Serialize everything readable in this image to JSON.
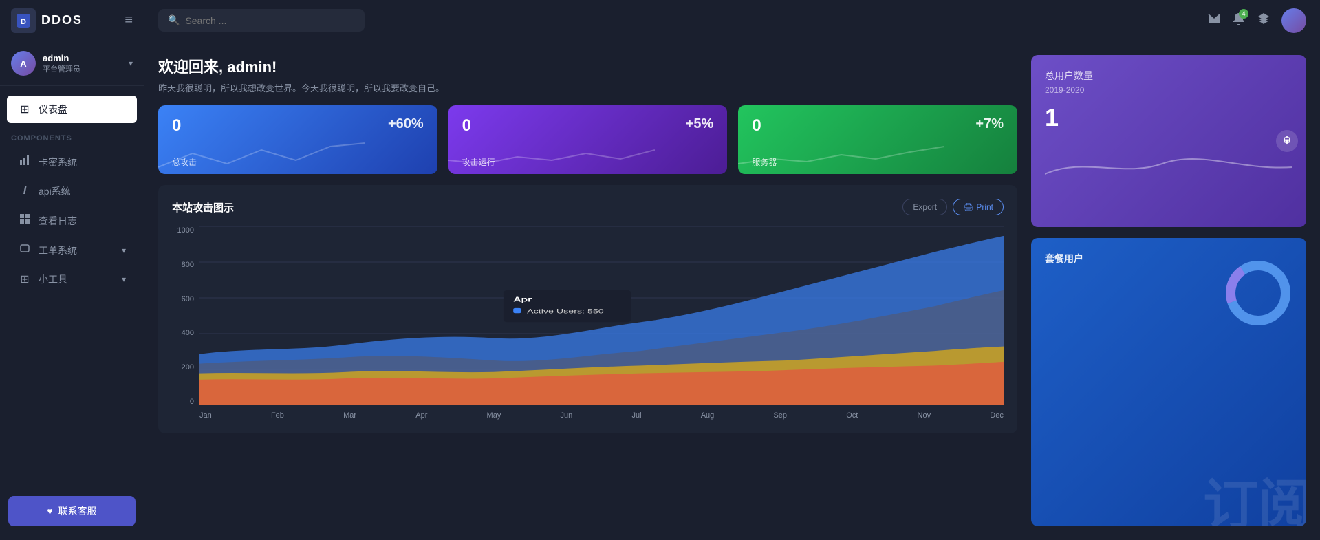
{
  "app": {
    "logo_text": "DDOS",
    "logo_icon": "D"
  },
  "sidebar": {
    "hamburger": "≡",
    "user": {
      "name": "admin",
      "role": "平台管理员"
    },
    "nav": [
      {
        "id": "dashboard",
        "label": "仪表盘",
        "icon": "⊞",
        "active": true
      }
    ],
    "components_label": "COMPONENTS",
    "component_items": [
      {
        "id": "card-system",
        "label": "卡密系统",
        "icon": "📊"
      },
      {
        "id": "api-system",
        "label": "api系统",
        "icon": "I"
      },
      {
        "id": "view-log",
        "label": "查看日志",
        "icon": "▦"
      },
      {
        "id": "ticket-system",
        "label": "工单系统",
        "icon": "▭",
        "has_arrow": true
      },
      {
        "id": "tools",
        "label": "小工具",
        "icon": "⊞",
        "has_arrow": true
      }
    ],
    "contact_btn": "联系客服"
  },
  "topbar": {
    "search_placeholder": "Search ...",
    "icons": {
      "mail": "✉",
      "bell": "🔔",
      "bell_badge": "4",
      "layers": "⧉"
    }
  },
  "welcome": {
    "title": "欢迎回来, admin!",
    "subtitle": "昨天我很聪明，所以我想改变世界。今天我很聪明，所以我要改变自己。"
  },
  "stat_cards": [
    {
      "id": "total-attacks",
      "value": "0",
      "label": "总攻击",
      "change": "+60%",
      "color": "blue"
    },
    {
      "id": "running-attacks",
      "value": "0",
      "label": "攻击运行",
      "change": "+5%",
      "color": "purple"
    },
    {
      "id": "servers",
      "value": "0",
      "label": "服务器",
      "change": "+7%",
      "color": "green"
    }
  ],
  "chart": {
    "title": "本站攻击图示",
    "export_btn": "Export",
    "print_btn": "Print",
    "y_axis": [
      "1000",
      "800",
      "600",
      "400",
      "200",
      "0"
    ],
    "x_axis": [
      "Jan",
      "Feb",
      "Mar",
      "Apr",
      "May",
      "Jun",
      "Jul",
      "Aug",
      "Sep",
      "Oct",
      "Nov",
      "Dec"
    ],
    "tooltip": {
      "month": "Apr",
      "label": "Active Users",
      "value": "550"
    }
  },
  "right_panel": {
    "total_users": {
      "title": "总用户数量",
      "period": "2019-2020",
      "value": "1"
    },
    "package_users": {
      "title": "套餐用户",
      "bg_text": "订阅"
    }
  }
}
